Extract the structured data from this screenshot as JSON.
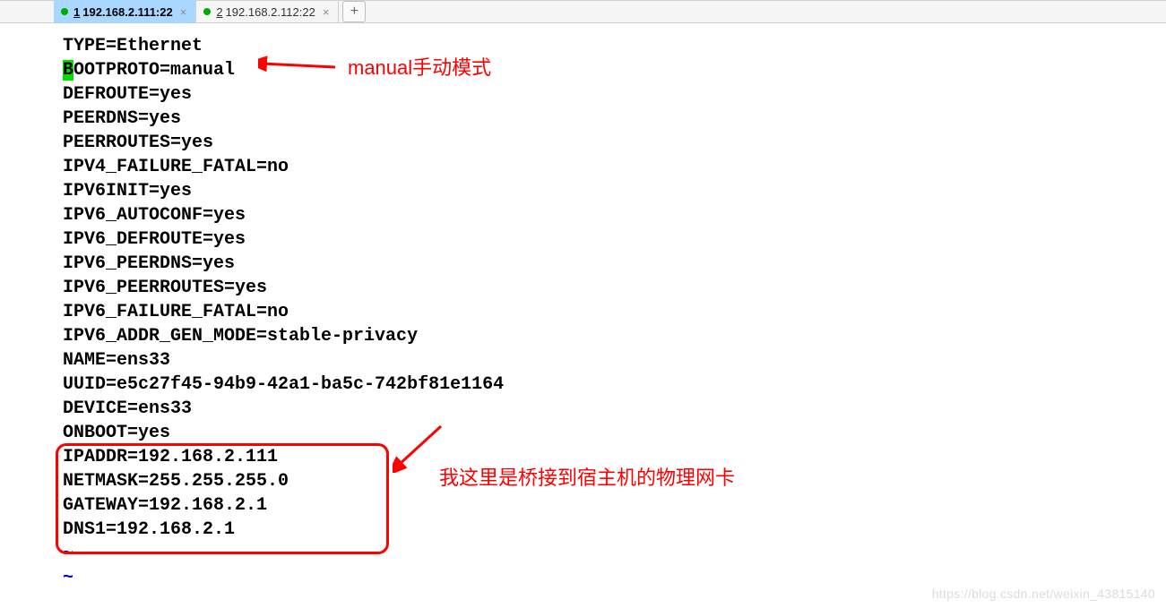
{
  "tabs": [
    {
      "num": "1",
      "label": "192.168.2.111:22",
      "active": true
    },
    {
      "num": "2",
      "label": "192.168.2.112:22",
      "active": false
    }
  ],
  "config": {
    "l0": "TYPE=Ethernet",
    "l1_pre": "B",
    "l1_rest": "OOTPROTO=manual",
    "l2": "DEFROUTE=yes",
    "l3": "PEERDNS=yes",
    "l4": "PEERROUTES=yes",
    "l5": "IPV4_FAILURE_FATAL=no",
    "l6": "IPV6INIT=yes",
    "l7": "IPV6_AUTOCONF=yes",
    "l8": "IPV6_DEFROUTE=yes",
    "l9": "IPV6_PEERDNS=yes",
    "l10": "IPV6_PEERROUTES=yes",
    "l11": "IPV6_FAILURE_FATAL=no",
    "l12": "IPV6_ADDR_GEN_MODE=stable-privacy",
    "l13": "NAME=ens33",
    "l14": "UUID=e5c27f45-94b9-42a1-ba5c-742bf81e1164",
    "l15": "DEVICE=ens33",
    "l16": "ONBOOT=yes",
    "l17": "IPADDR=192.168.2.111",
    "l18": "NETMASK=255.255.255.0",
    "l19": "GATEWAY=192.168.2.1",
    "l20": "DNS1=192.168.2.1",
    "t1": "~",
    "t2": "~"
  },
  "annotations": {
    "a1": "manual手动模式",
    "a2": "我这里是桥接到宿主机的物理网卡"
  },
  "watermark": "https://blog.csdn.net/weixin_43815140"
}
